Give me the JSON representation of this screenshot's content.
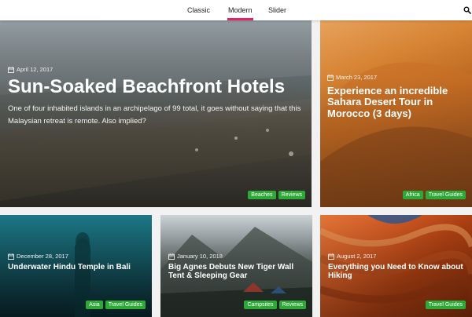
{
  "nav": {
    "tabs": [
      {
        "label": "Classic",
        "active": false
      },
      {
        "label": "Modern",
        "active": true
      },
      {
        "label": "Slider",
        "active": false
      }
    ],
    "search_icon": "search-icon"
  },
  "accent": "#e91e63",
  "tag_color": "#2ea836",
  "cards": [
    {
      "date": "April 12, 2017",
      "title": "Sun-Soaked Beachfront Hotels",
      "excerpt": "One of four inhabited islands in an archipelago of 99 total, it goes without saying that this Malaysian retreat is remote. Also implied?",
      "tags": [
        "Beaches",
        "Reviews"
      ]
    },
    {
      "date": "March 23, 2017",
      "title": "Experience an incredible Sahara Desert Tour in Morocco (3 days)",
      "tags": [
        "Africa",
        "Travel Guides"
      ]
    },
    {
      "date": "December 28, 2017",
      "title": "Underwater Hindu Temple in Bali",
      "tags": [
        "Asia",
        "Travel Guides"
      ]
    },
    {
      "date": "January 10, 2018",
      "title": "Big Agnes Debuts New Tiger Wall Tent & Sleeping Gear",
      "tags": [
        "Campsites",
        "Reviews"
      ]
    },
    {
      "date": "August 2, 2017",
      "title": "Everything you Need to Know about Hiking",
      "tags": [
        "Travel Guides"
      ]
    }
  ]
}
